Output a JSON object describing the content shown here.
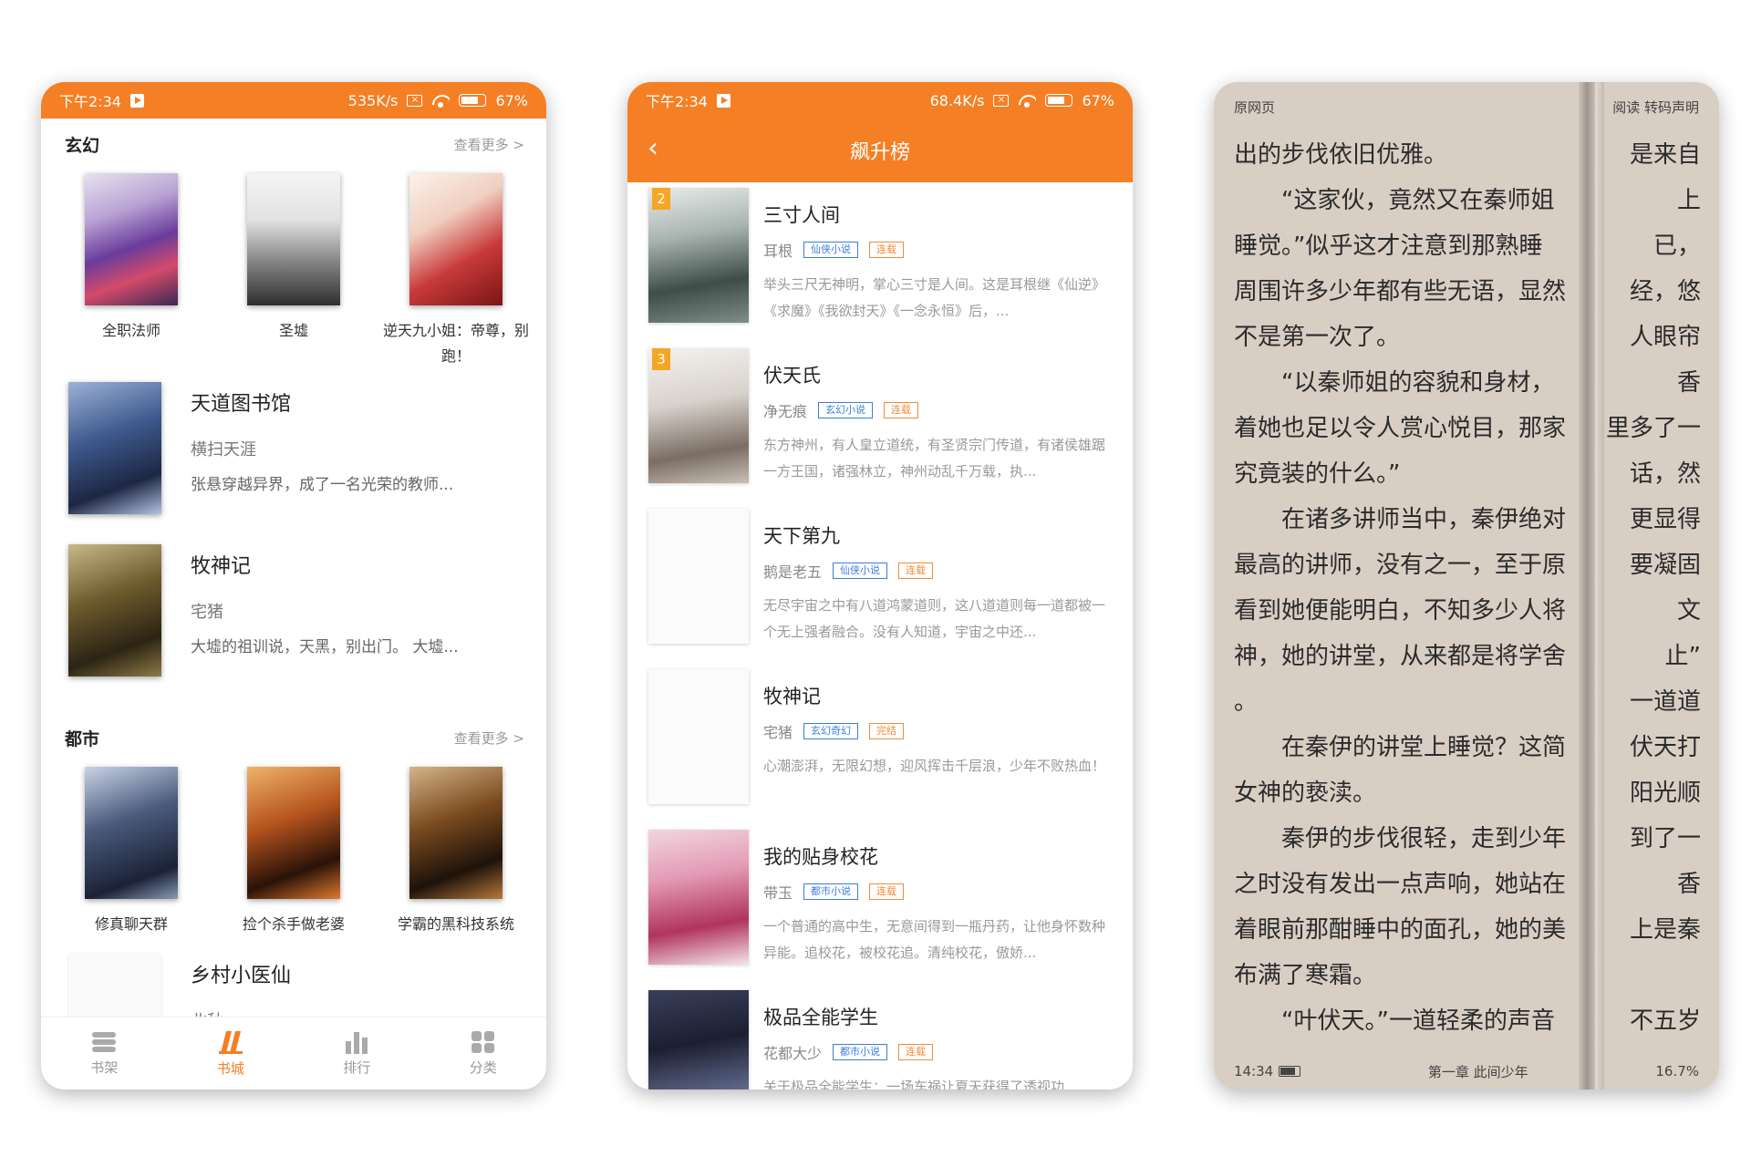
{
  "colors": {
    "accent": "#f57f25",
    "reader_bg": "#d9cec4"
  },
  "phone1": {
    "status": {
      "time": "下午2:34",
      "speed": "535K/s",
      "battery": "67%"
    },
    "xuanhuan": {
      "title": "玄幻",
      "more": "查看更多 >",
      "grid": [
        {
          "name": "全职法师"
        },
        {
          "name": "圣墟"
        },
        {
          "name": "逆天九小姐：帝尊，别跑！"
        }
      ],
      "list": [
        {
          "title": "天道图书馆",
          "author": "横扫天涯",
          "desc": "张悬穿越异界，成了一名光荣的教师..."
        },
        {
          "title": "牧神记",
          "author": "宅猪",
          "desc": "大墟的祖训说，天黑，别出门。 大墟..."
        }
      ]
    },
    "dushi": {
      "title": "都市",
      "more": "查看更多 >",
      "grid": [
        {
          "name": "修真聊天群"
        },
        {
          "name": "捡个杀手做老婆"
        },
        {
          "name": "学霸的黑科技系统"
        }
      ],
      "list": [
        {
          "title": "乡村小医仙",
          "author": "北秋"
        }
      ]
    },
    "tabs": [
      {
        "label": "书架",
        "icon": "bookshelf-icon"
      },
      {
        "label": "书城",
        "icon": "bookstore-icon"
      },
      {
        "label": "排行",
        "icon": "ranking-icon"
      },
      {
        "label": "分类",
        "icon": "category-icon"
      }
    ]
  },
  "phone2": {
    "status": {
      "time": "下午2:34",
      "speed": "68.4K/s",
      "battery": "67%"
    },
    "title": "飙升榜",
    "items": [
      {
        "rank": "2",
        "title": "三寸人间",
        "author": "耳根",
        "tag1": "仙侠小说",
        "tag2": "连载",
        "desc": "举头三尺无神明，掌心三寸是人间。这是耳根继《仙逆》《求魔》《我欲封天》《一念永恒》后，..."
      },
      {
        "rank": "3",
        "title": "伏天氏",
        "author": "净无痕",
        "tag1": "玄幻小说",
        "tag2": "连载",
        "desc": "东方神州，有人皇立道统，有圣贤宗门传道，有诸侯雄踞一方王国，诸强林立，神州动乱千万载，执..."
      },
      {
        "rank": "",
        "title": "天下第九",
        "author": "鹅是老五",
        "tag1": "仙侠小说",
        "tag2": "连载",
        "desc": "无尽宇宙之中有八道鸿蒙道则，这八道道则每一道都被一个无上强者融合。没有人知道，宇宙之中还..."
      },
      {
        "rank": "",
        "title": "牧神记",
        "author": "宅猪",
        "tag1": "玄幻奇幻",
        "tag2": "完结",
        "desc": "心潮澎湃，无限幻想，迎风挥击千层浪，少年不败热血！"
      },
      {
        "rank": "",
        "title": "我的贴身校花",
        "author": "带玉",
        "tag1": "都市小说",
        "tag2": "连载",
        "desc": "一个普通的高中生，无意间得到一瓶丹药，让他身怀数种异能。追校花，被校花追。清纯校花，傲娇..."
      },
      {
        "rank": "",
        "title": "极品全能学生",
        "author": "花都大少",
        "tag1": "都市小说",
        "tag2": "连载",
        "desc": "关于极品全能学生：一场车祸让夏天获得了透视功"
      }
    ]
  },
  "phone3": {
    "top_left": "原网页",
    "top_right": "阅读 转码声明",
    "lines": [
      "出的步伐依旧优雅。",
      "　　“这家伙，竟然又在秦师姐",
      "睡觉。”似乎这才注意到那熟睡",
      "周围许多少年都有些无语，显然",
      "不是第一次了。",
      "　　“以秦师姐的容貌和身材，",
      "着她也足以令人赏心悦目，那家",
      "究竟装的什么。”",
      "　　在诸多讲师当中，秦伊绝对",
      "最高的讲师，没有之一，至于原",
      "看到她便能明白，不知多少人将",
      "神，她的讲堂，从来都是将学舍",
      "。",
      "　　在秦伊的讲堂上睡觉？这简",
      "女神的亵渎。",
      "　　秦伊的步伐很轻，走到少年",
      "之时没有发出一点声响，她站在",
      "着眼前那酣睡中的面孔，她的美",
      "布满了寒霜。",
      "　　“叶伏天。”一道轻柔的声音"
    ],
    "right_strip": [
      "是来自",
      "上",
      "已，",
      "经，悠",
      "人眼帘",
      "香",
      "里多了一",
      "话，然",
      "更显得",
      "要凝固",
      "文",
      "止”",
      "一道道",
      "伏天打",
      "阳光顺",
      "到了一",
      "香",
      "上是秦",
      "",
      "不五岁"
    ],
    "bottom_time": "14:34",
    "bottom_chapter": "第一章 此间少年",
    "bottom_percent": "16.7%"
  }
}
